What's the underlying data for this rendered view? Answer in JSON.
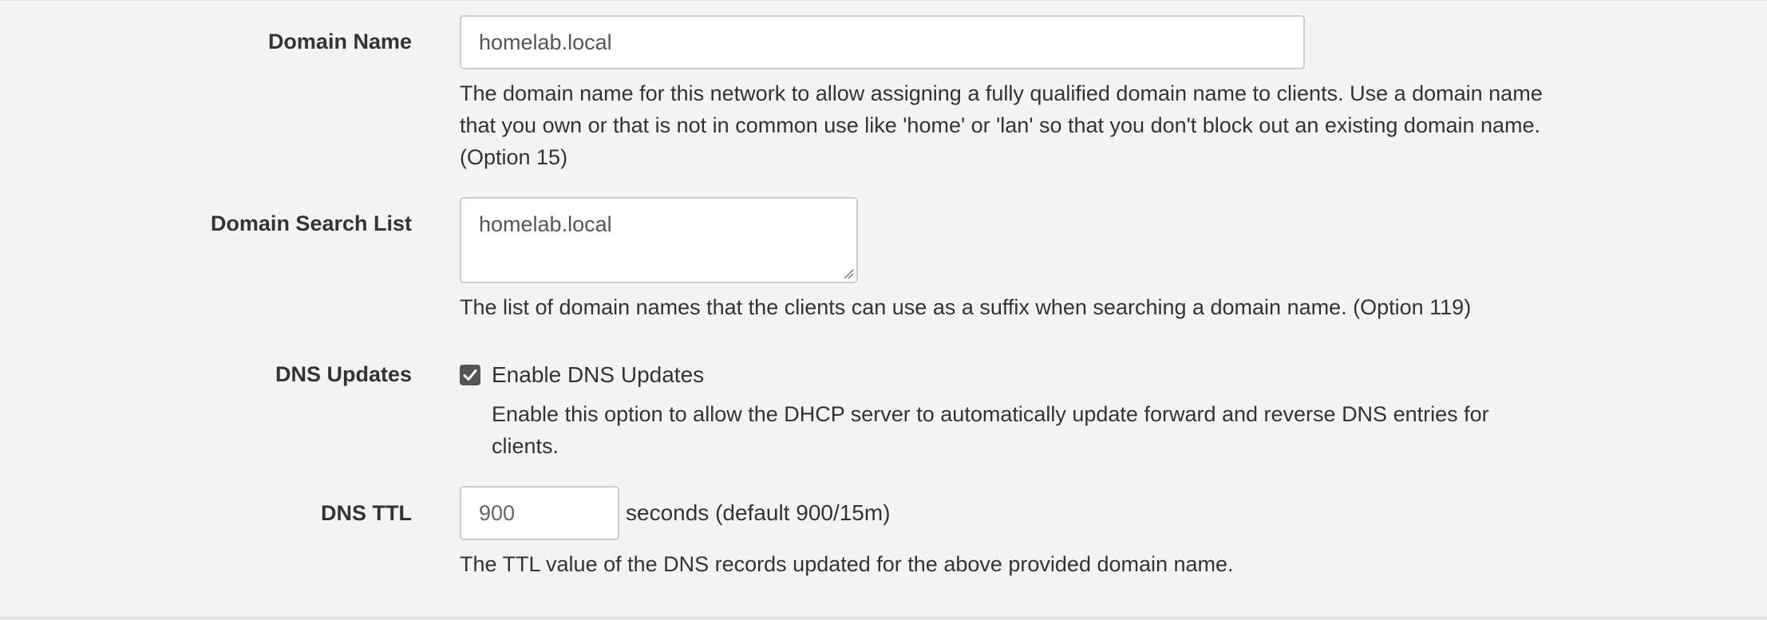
{
  "domain_name": {
    "label": "Domain Name",
    "value": "homelab.local",
    "help_line1": "The domain name for this network to allow assigning a fully qualified domain name to clients. Use a domain name",
    "help_line2": "that you own or that is not in common use like 'home' or 'lan' so that you don't block out an existing domain name.",
    "help_line3": "(Option 15)"
  },
  "domain_search_list": {
    "label": "Domain Search List",
    "value": "homelab.local",
    "help": "The list of domain names that the clients can use as a suffix when searching a domain name. (Option 119)"
  },
  "dns_updates": {
    "label": "DNS Updates",
    "checkbox_label": "Enable DNS Updates",
    "checked": true,
    "help_line1": "Enable this option to allow the DHCP server to automatically update forward and reverse DNS entries for",
    "help_line2": "clients."
  },
  "dns_ttl": {
    "label": "DNS TTL",
    "placeholder": "900",
    "value": "",
    "suffix": "seconds (default 900/15m)",
    "help": "The TTL value of the DNS records updated for the above provided domain name."
  },
  "colors": {
    "background": "#f4f4f4",
    "input_border": "#cccccc",
    "text": "#333333",
    "checkbox": "#555555"
  }
}
